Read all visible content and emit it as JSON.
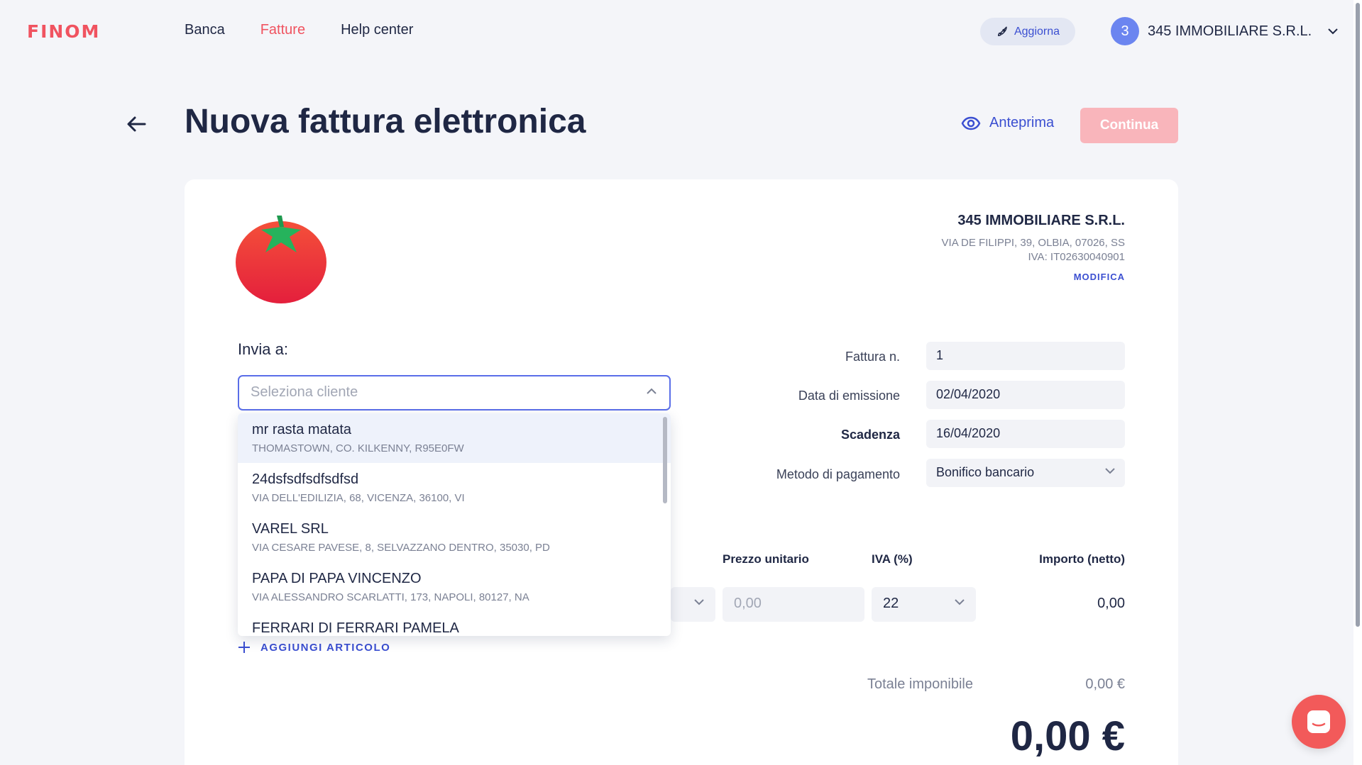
{
  "brand": "FINOM",
  "nav": {
    "items": [
      {
        "label": "Banca",
        "active": false
      },
      {
        "label": "Fatture",
        "active": true
      },
      {
        "label": "Help center",
        "active": false
      }
    ]
  },
  "upgrade": {
    "label": "Aggiorna",
    "icon": "rocket-icon"
  },
  "account": {
    "initial": "3",
    "name": "345 IMMOBILIARE S.R.L."
  },
  "header": {
    "title": "Nuova fattura elettronica",
    "preview_label": "Anteprima",
    "continue_label": "Continua"
  },
  "company": {
    "name": "345 IMMOBILIARE S.R.L.",
    "address": "VIA DE FILIPPI, 39, OLBIA, 07026, SS",
    "vat": "IVA: IT02630040901",
    "edit_label": "MODIFICA"
  },
  "recipient": {
    "label": "Invia a:",
    "placeholder": "Seleziona cliente",
    "options": [
      {
        "name": "mr rasta matata",
        "address": "THOMASTOWN, CO. KILKENNY, R95E0FW"
      },
      {
        "name": "24dsfsdfsdfsdfsd",
        "address": "VIA DELL'EDILIZIA, 68, VICENZA, 36100, VI"
      },
      {
        "name": "VAREL SRL",
        "address": "VIA CESARE PAVESE, 8, SELVAZZANO DENTRO, 35030, PD"
      },
      {
        "name": "PAPA DI PAPA VINCENZO",
        "address": "VIA ALESSANDRO SCARLATTI, 173, NAPOLI, 80127, NA"
      },
      {
        "name": "FERRARI DI FERRARI PAMELA",
        "address": ""
      }
    ]
  },
  "invoice": {
    "number_label": "Fattura n.",
    "number": "1",
    "issue_label": "Data di emissione",
    "issue_date": "02/04/2020",
    "due_label": "Scadenza",
    "due_date": "16/04/2020",
    "payment_label": "Metodo di pagamento",
    "payment_method": "Bonifico bancario"
  },
  "items": {
    "headers": {
      "unit_price": "Prezzo unitario",
      "vat": "IVA (%)",
      "amount": "Importo (netto)"
    },
    "row": {
      "unit_price_placeholder": "0,00",
      "vat": "22",
      "amount": "0,00"
    },
    "add_label": "AGGIUNGI ARTICOLO"
  },
  "totals": {
    "subtotal_label": "Totale imponibile",
    "subtotal": "0,00 €",
    "total": "0,00 €"
  },
  "colors": {
    "accent": "#f05360",
    "primary": "#3b4fd1",
    "text": "#1f2744"
  }
}
